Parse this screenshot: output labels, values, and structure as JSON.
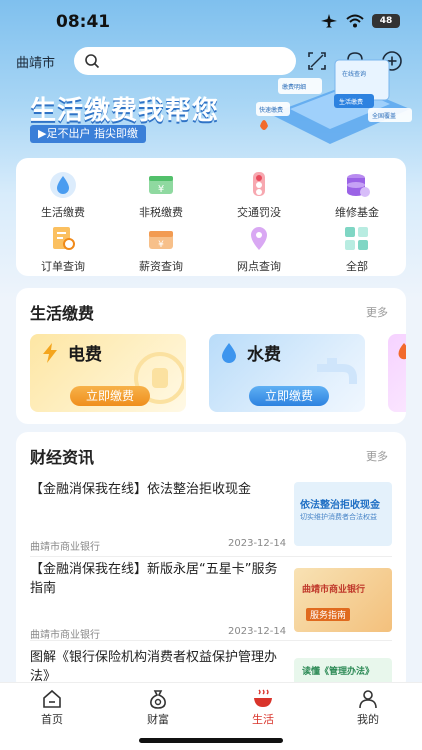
{
  "status": {
    "time": "08:41",
    "battery": "48"
  },
  "header": {
    "city": "曲靖市",
    "search_placeholder": ""
  },
  "banner": {
    "title": "生活缴费我帮您",
    "subtitle": "▶足不出户 指尖即缴",
    "art_labels": [
      "缴费明细",
      "在线查询",
      "快速缴费",
      "全国覆盖",
      "生活缴费"
    ]
  },
  "menu": {
    "items": [
      {
        "label": "生活缴费",
        "icon": "drop-icon"
      },
      {
        "label": "非税缴费",
        "icon": "yuan-wallet-icon"
      },
      {
        "label": "交通罚没",
        "icon": "traffic-light-icon"
      },
      {
        "label": "维修基金",
        "icon": "coin-stack-icon"
      },
      {
        "label": "订单查询",
        "icon": "order-search-icon"
      },
      {
        "label": "薪资查询",
        "icon": "salary-icon"
      },
      {
        "label": "网点查询",
        "icon": "location-pin-icon"
      },
      {
        "label": "全部",
        "icon": "grid-icon"
      }
    ]
  },
  "life_pay": {
    "title": "生活缴费",
    "more": "更多",
    "tiles": [
      {
        "name": "电费",
        "button": "立即缴费",
        "icon": "lightning-icon"
      },
      {
        "name": "水费",
        "button": "立即缴费",
        "icon": "water-drop-icon"
      }
    ]
  },
  "news": {
    "title": "财经资讯",
    "more": "更多",
    "items": [
      {
        "title": "【金融消保我在线】依法整治拒收现金",
        "source": "曲靖市商业银行",
        "date": "2023-12-14",
        "thumb_text": "依法整治拒收现金",
        "thumb_sub": "切实维护消费者合法权益"
      },
      {
        "title": "【金融消保我在线】新版永居“五星卡”服务指南",
        "source": "曲靖市商业银行",
        "date": "2023-12-14",
        "thumb_text": "曲靖市商业银行",
        "thumb_sub": "服务指南"
      },
      {
        "title": "图解《银行保险机构消费者权益保护管理办法》",
        "source": "",
        "date": "",
        "thumb_text": "读懂《管理办法》",
        "thumb_sub": ""
      }
    ]
  },
  "tabbar": {
    "tabs": [
      {
        "label": "首页",
        "icon": "home-icon"
      },
      {
        "label": "财富",
        "icon": "money-bag-icon"
      },
      {
        "label": "生活",
        "icon": "hotpot-icon"
      },
      {
        "label": "我的",
        "icon": "person-icon"
      }
    ],
    "active": "生活",
    "active_color": "#d9342b"
  },
  "colors": {
    "accent": "#2d82e0",
    "electric": "#ef8e1c",
    "active_tab": "#d9342b"
  }
}
